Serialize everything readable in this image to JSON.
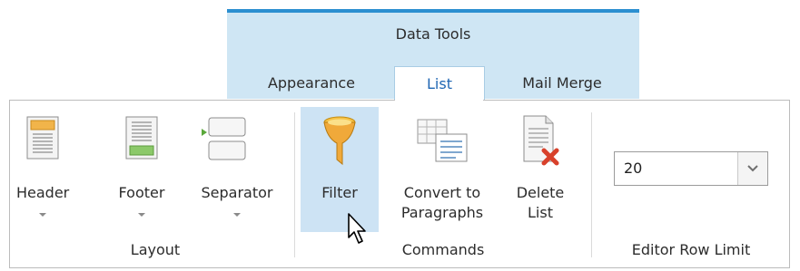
{
  "context_tab_group": {
    "title": "Data Tools",
    "accent_color": "#2b8fd0",
    "background_color": "#cfe6f4"
  },
  "tabs": [
    {
      "label": "Appearance",
      "active": false
    },
    {
      "label": "List",
      "active": true
    },
    {
      "label": "Mail Merge",
      "active": false
    }
  ],
  "groups": {
    "layout": {
      "label": "Layout",
      "buttons": [
        {
          "label": "Header",
          "icon": "header-icon",
          "has_dropdown": true
        },
        {
          "label": "Footer",
          "icon": "footer-icon",
          "has_dropdown": true
        },
        {
          "label": "Separator",
          "icon": "separator-icon",
          "has_dropdown": true
        }
      ]
    },
    "commands": {
      "label": "Commands",
      "buttons": [
        {
          "label": "Filter",
          "icon": "funnel-icon",
          "hovered": true
        },
        {
          "label": "Convert to Paragraphs",
          "line1": "Convert to",
          "line2": "Paragraphs",
          "icon": "convert-paragraphs-icon"
        },
        {
          "label": "Delete List",
          "line1": "Delete",
          "line2": "List",
          "icon": "delete-list-icon"
        }
      ]
    },
    "editor_row_limit": {
      "label": "Editor Row Limit",
      "combo": {
        "value": "20",
        "icon": "chevron-down-icon"
      }
    }
  },
  "cursor": {
    "icon": "mouse-pointer-icon"
  }
}
